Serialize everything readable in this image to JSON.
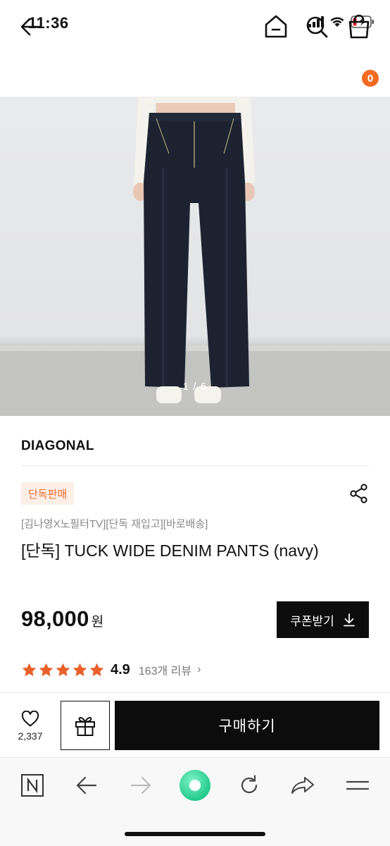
{
  "status_bar": {
    "time": "11:36"
  },
  "header": {
    "cart_count": "0"
  },
  "image": {
    "counter": "1 / 6"
  },
  "product": {
    "brand": "DIAGONAL",
    "tag": "단독판매",
    "promo": "[김나영X노필터TV][단독 재입고][바로배송]",
    "title": "[단독] TUCK WIDE DENIM PANTS (navy)",
    "price": "98,000",
    "currency": "원",
    "coupon_label": "쿠폰받기",
    "rating": "4.9",
    "stars": 5,
    "review_count": "163개 리뷰",
    "review_chevron": "›"
  },
  "purchase_bar": {
    "like_count": "2,337",
    "buy_label": "구매하기"
  },
  "icons": {
    "back": "back-arrow-icon",
    "home": "home-icon",
    "search": "search-icon",
    "cart": "shopping-bag-icon",
    "share": "share-icon",
    "heart": "heart-icon",
    "gift": "gift-icon",
    "download": "download-icon"
  },
  "colors": {
    "accent": "#f26b21",
    "tag_bg": "#fcefe7",
    "tag_text": "#ea6a2b",
    "star": "#e8602a",
    "button_dark": "#0c0c0c",
    "green_ball": "#2fd99a"
  }
}
